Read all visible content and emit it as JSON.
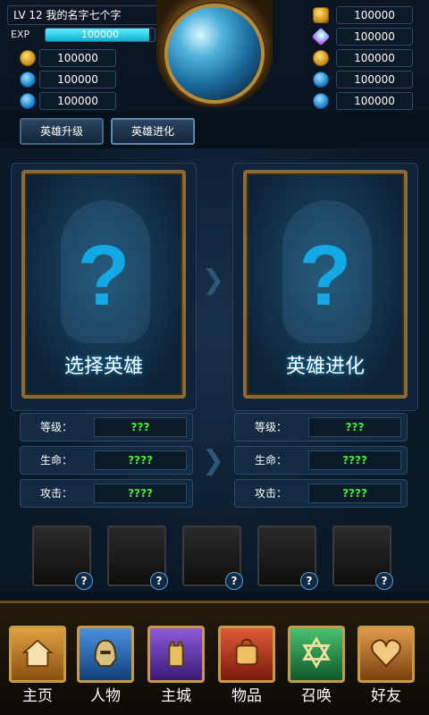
{
  "player": {
    "level_text": "LV  12  我的名字七个字",
    "exp_label": "EXP",
    "exp_value": "100000",
    "exp_progress": 0.95
  },
  "currencies_left": [
    {
      "icon": "gold-coin-icon",
      "value": "100000"
    },
    {
      "icon": "blue-orb-icon",
      "value": "100000"
    },
    {
      "icon": "blue-orb-icon",
      "value": "100000"
    }
  ],
  "currencies_right": [
    {
      "icon": "gold-bag-icon",
      "value": "100000"
    },
    {
      "icon": "diamond-icon",
      "value": "100000"
    },
    {
      "icon": "gold-coin-icon",
      "value": "100000"
    },
    {
      "icon": "blue-orb-icon",
      "value": "100000"
    },
    {
      "icon": "blue-orb-icon",
      "value": "100000"
    }
  ],
  "tabs": [
    {
      "label": "英雄升级"
    },
    {
      "label": "英雄进化"
    }
  ],
  "cards": [
    {
      "symbol": "?",
      "label": "选择英雄"
    },
    {
      "symbol": "?",
      "label": "英雄进化"
    }
  ],
  "stats_left": [
    {
      "label": "等级：",
      "value": "???"
    },
    {
      "label": "生命：",
      "value": "????"
    },
    {
      "label": "攻击：",
      "value": "????"
    }
  ],
  "stats_right": [
    {
      "label": "等级：",
      "value": "???"
    },
    {
      "label": "生命：",
      "value": "????"
    },
    {
      "label": "攻击：",
      "value": "????"
    }
  ],
  "material_slots": [
    {
      "badge": "?"
    },
    {
      "badge": "?"
    },
    {
      "badge": "?"
    },
    {
      "badge": "?"
    },
    {
      "badge": "?"
    }
  ],
  "nav": [
    {
      "label": "主页",
      "icon": "house-icon",
      "color": "#c88a2a"
    },
    {
      "label": "人物",
      "icon": "helmet-icon",
      "color": "#2a6ec8"
    },
    {
      "label": "主城",
      "icon": "castle-tower-icon",
      "color": "#6a3ab8"
    },
    {
      "label": "物品",
      "icon": "backpack-icon",
      "color": "#c83a2a"
    },
    {
      "label": "召唤",
      "icon": "star-of-david-icon",
      "color": "#2a9a4a"
    },
    {
      "label": "好友",
      "icon": "heart-icon",
      "color": "#c87a2a"
    }
  ]
}
